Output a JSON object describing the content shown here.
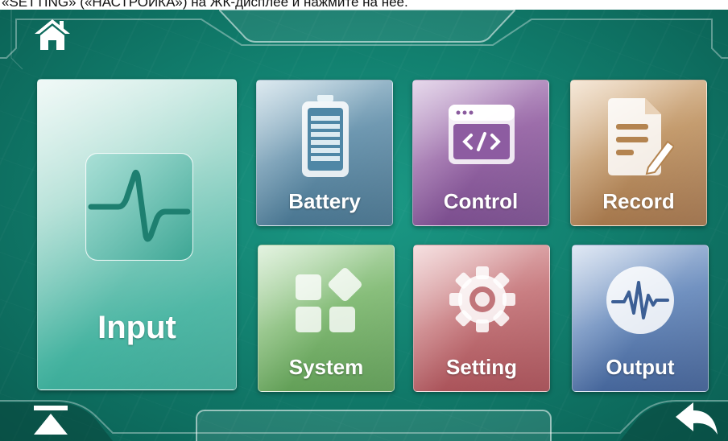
{
  "caption": "«SETTING» («НАСТРОЙКА») на ЖК-дисплее и нажмите на нее.",
  "tiles": {
    "input": "Input",
    "battery": "Battery",
    "control": "Control",
    "record": "Record",
    "system": "System",
    "setting": "Setting",
    "output": "Output"
  },
  "icons": {
    "home": "home-icon",
    "scroll_top": "scroll-to-top-icon",
    "back": "back-arrow-icon"
  },
  "colors": {
    "background": "#12806f",
    "accent": "#ffffff"
  }
}
